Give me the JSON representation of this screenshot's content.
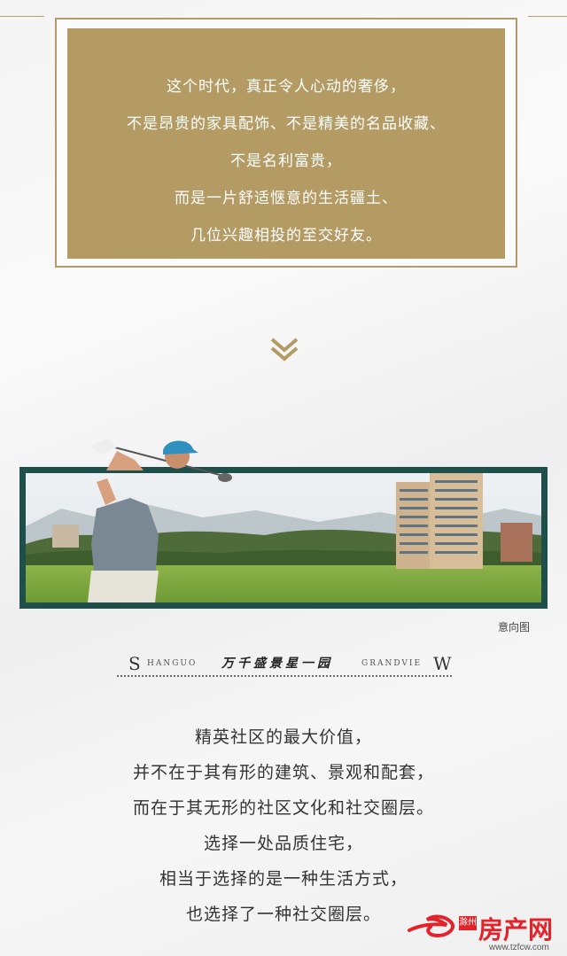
{
  "quote": {
    "lines": [
      "这个时代，真正令人心动的奢侈，",
      "不是昂贵的家具配饰、不是精美的名品收藏、",
      "不是名利富贵，",
      "而是一片舒适惬意的生活疆土、",
      "几位兴趣相投的至交好友。"
    ]
  },
  "icons": {
    "scroll": "double-chevron-down-icon"
  },
  "photo": {
    "caption": "意向图"
  },
  "brand": {
    "initial_left": "S",
    "text_left": "HANGUO",
    "chinese": "万千盛景星一园",
    "text_right": "GRANDVIE",
    "initial_right": "W"
  },
  "body": {
    "lines": [
      "精英社区的最大价值，",
      "并不在于其有形的建筑、景观和配套，",
      "而在于其无形的社区文化和社交圈层。",
      "选择一处品质住宅，",
      "相当于选择的是一种生活方式，",
      "也选择了一种社交圈层。"
    ]
  },
  "watermark": {
    "city": "滁州",
    "name": "房产网",
    "url": "www.tzfcw.com"
  },
  "colors": {
    "gold": "#b39b63",
    "frame_green": "#1f4f4b",
    "logo_red": "#e3222a"
  }
}
